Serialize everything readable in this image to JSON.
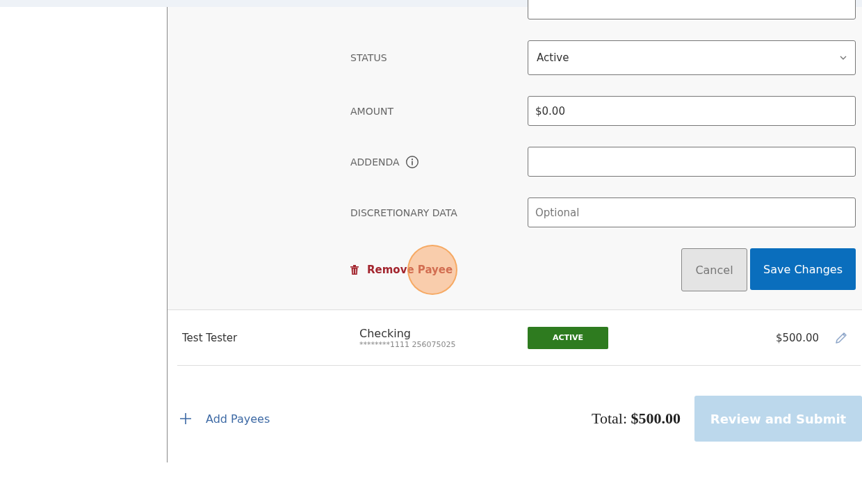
{
  "edit_form": {
    "fields": [
      {
        "label": "STATUS",
        "kind": "select",
        "value": "Active"
      },
      {
        "label": "AMOUNT",
        "kind": "input",
        "value": "$0.00"
      },
      {
        "label": "ADDENDA",
        "kind": "input",
        "info": true
      },
      {
        "label": "DISCRETIONARY DATA",
        "kind": "input",
        "placeholder": "Optional"
      }
    ],
    "remove_link": "Remove Payee",
    "cancel_button": "Cancel",
    "save_button": "Save Changes"
  },
  "payees": [
    {
      "name": "Test Tester",
      "account_type": "Checking",
      "account_number": "********1111 256075025",
      "status": "ACTIVE",
      "amount": "$500.00"
    }
  ],
  "footer": {
    "add_link": "Add Payees",
    "total_label": "Total:",
    "total_value": "$500.00",
    "submit_button": {
      "label": "Review and Submit",
      "disabled": true
    }
  }
}
